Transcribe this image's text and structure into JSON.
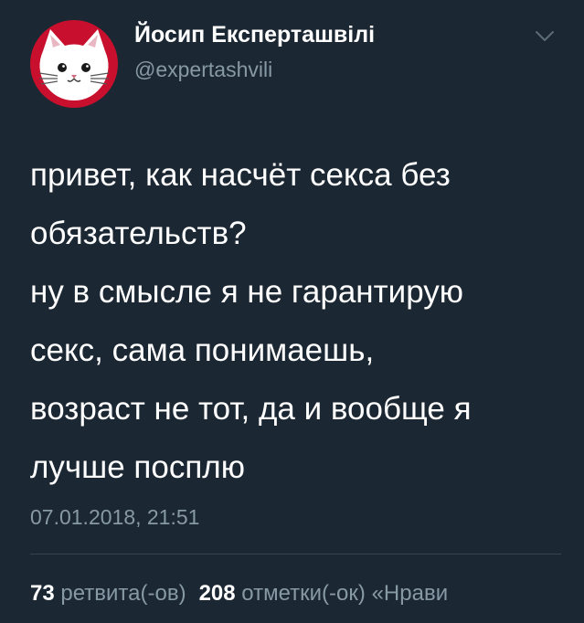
{
  "tweet": {
    "author": {
      "display_name": "Йосип Експерташвілі",
      "handle": "@expertashvili",
      "avatar_icon": "cat-avatar-icon",
      "avatar_bg": "#c8102e"
    },
    "menu_icon": "chevron-down-icon",
    "text_lines": [
      "привет, как насчёт секса без",
      "обязательств?",
      "ну в смысле я не гарантирую",
      "секс, сама понимаешь,",
      "возраст не тот, да и вообще я",
      "лучше посплю"
    ],
    "timestamp": "07.01.2018, 21:51",
    "stats": {
      "retweets_count": "73",
      "retweets_label": "ретвита(-ов)",
      "likes_count": "208",
      "likes_label": "отметки(-ок)",
      "likes_extra": "«Нрави"
    }
  },
  "colors": {
    "background": "#1b2733",
    "primary_text": "#ffffff",
    "secondary_text": "#8899a6",
    "divider": "#38444d"
  }
}
